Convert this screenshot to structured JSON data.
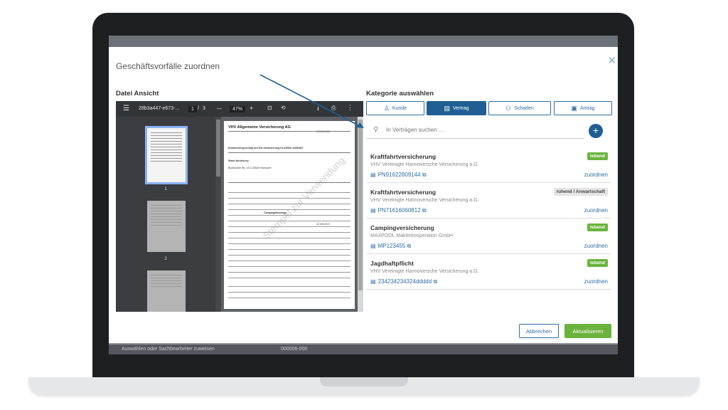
{
  "modal": {
    "title": "Geschäftsvorfälle zuordnen",
    "close_glyph": "✕",
    "left_title": "Datei Ansicht",
    "right_title": "Kategorie auswählen"
  },
  "pdf": {
    "filename": "28b3a447-e673-...",
    "page_current": "1",
    "page_sep": "/",
    "page_total": "3",
    "zoom": "47%",
    "zoom_minus": "—",
    "zoom_plus": "+",
    "thumb_labels": [
      "1",
      "2"
    ],
    "doc_title": "VHV Allgemeine Versicherung AG",
    "doc_header_right": "000006-000",
    "doc_section": "Ersatzvertrag     Antrag auf Kfz-Versicherung KLASSIK-GARANT",
    "doc_person": "Stave Norderney",
    "doc_address": "Buchholzer Str. 14  D-30625 Hannover",
    "doc_vehicle": "Campingfahrzeuge",
    "doc_amount": "42.000,00 €",
    "doc_watermark": "Stempel zur Verwendung"
  },
  "categories": [
    {
      "label": "Kunde",
      "icon": "user-icon",
      "glyph": "♙",
      "active": false
    },
    {
      "label": "Vertrag",
      "icon": "contract-icon",
      "glyph": "▤",
      "active": true
    },
    {
      "label": "Schaden",
      "icon": "damage-icon",
      "glyph": "⚇",
      "active": false
    },
    {
      "label": "Antrag",
      "icon": "application-icon",
      "glyph": "▣",
      "active": false
    }
  ],
  "search": {
    "placeholder": "In Verträgen suchen ..."
  },
  "contracts": [
    {
      "title": "Kraftfahrtversicherung",
      "insurer": "VHV Vereinigte Hannoversche Versicherung a.G.",
      "number": "PN91622809144",
      "status": "lebend",
      "status_type": "green",
      "assign": "zuordnen"
    },
    {
      "title": "Kraftfahrtversicherung",
      "insurer": "VHV Vereinigte Hannoversche Versicherung a.G.",
      "number": "PN71616060812",
      "status": "ruhend / Anwartschaft",
      "status_type": "grey",
      "assign": "zuordnen"
    },
    {
      "title": "Campingversicherung",
      "insurer": "MAXPOOL Maklerkooperation GmbH",
      "number": "MP123455",
      "status": "lebend",
      "status_type": "green",
      "assign": "zuordnen"
    },
    {
      "title": "Jagdhaftpflicht",
      "insurer": "VHV Vereinigte Hannoversche Versicherung a.G.",
      "number": "234234234324ddddd",
      "status": "lebend",
      "status_type": "green",
      "assign": "zuordnen"
    }
  ],
  "actions": {
    "cancel": "Abbrechen",
    "update": "Aktualisieren"
  },
  "background": {
    "bottom_left": "Auswählen oder Sachbearbeiter zuweisen",
    "bottom_mid": "000006-000"
  },
  "colors": {
    "accent": "#1f5f93",
    "success": "#6bb33d"
  }
}
